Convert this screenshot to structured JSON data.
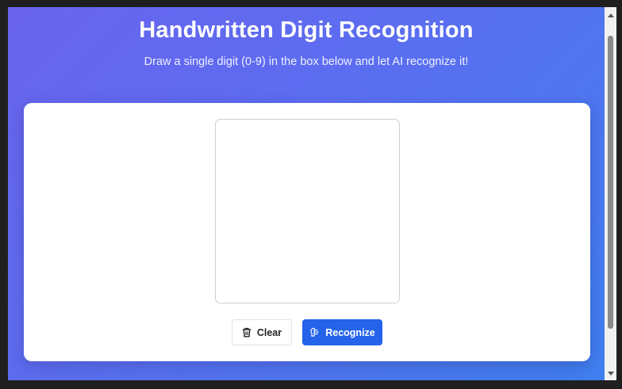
{
  "page": {
    "title": "Handwritten Digit Recognition",
    "subtitle": "Draw a single digit (0-9) in the box below and let AI recognize it!"
  },
  "actions": {
    "clear_label": "Clear",
    "clear_icon": "trash-icon",
    "recognize_label": "Recognize",
    "recognize_icon": "brain-icon"
  },
  "colors": {
    "gradient_start": "#6a63ee",
    "gradient_end": "#3f7ff0",
    "primary_button": "#2563eb"
  }
}
